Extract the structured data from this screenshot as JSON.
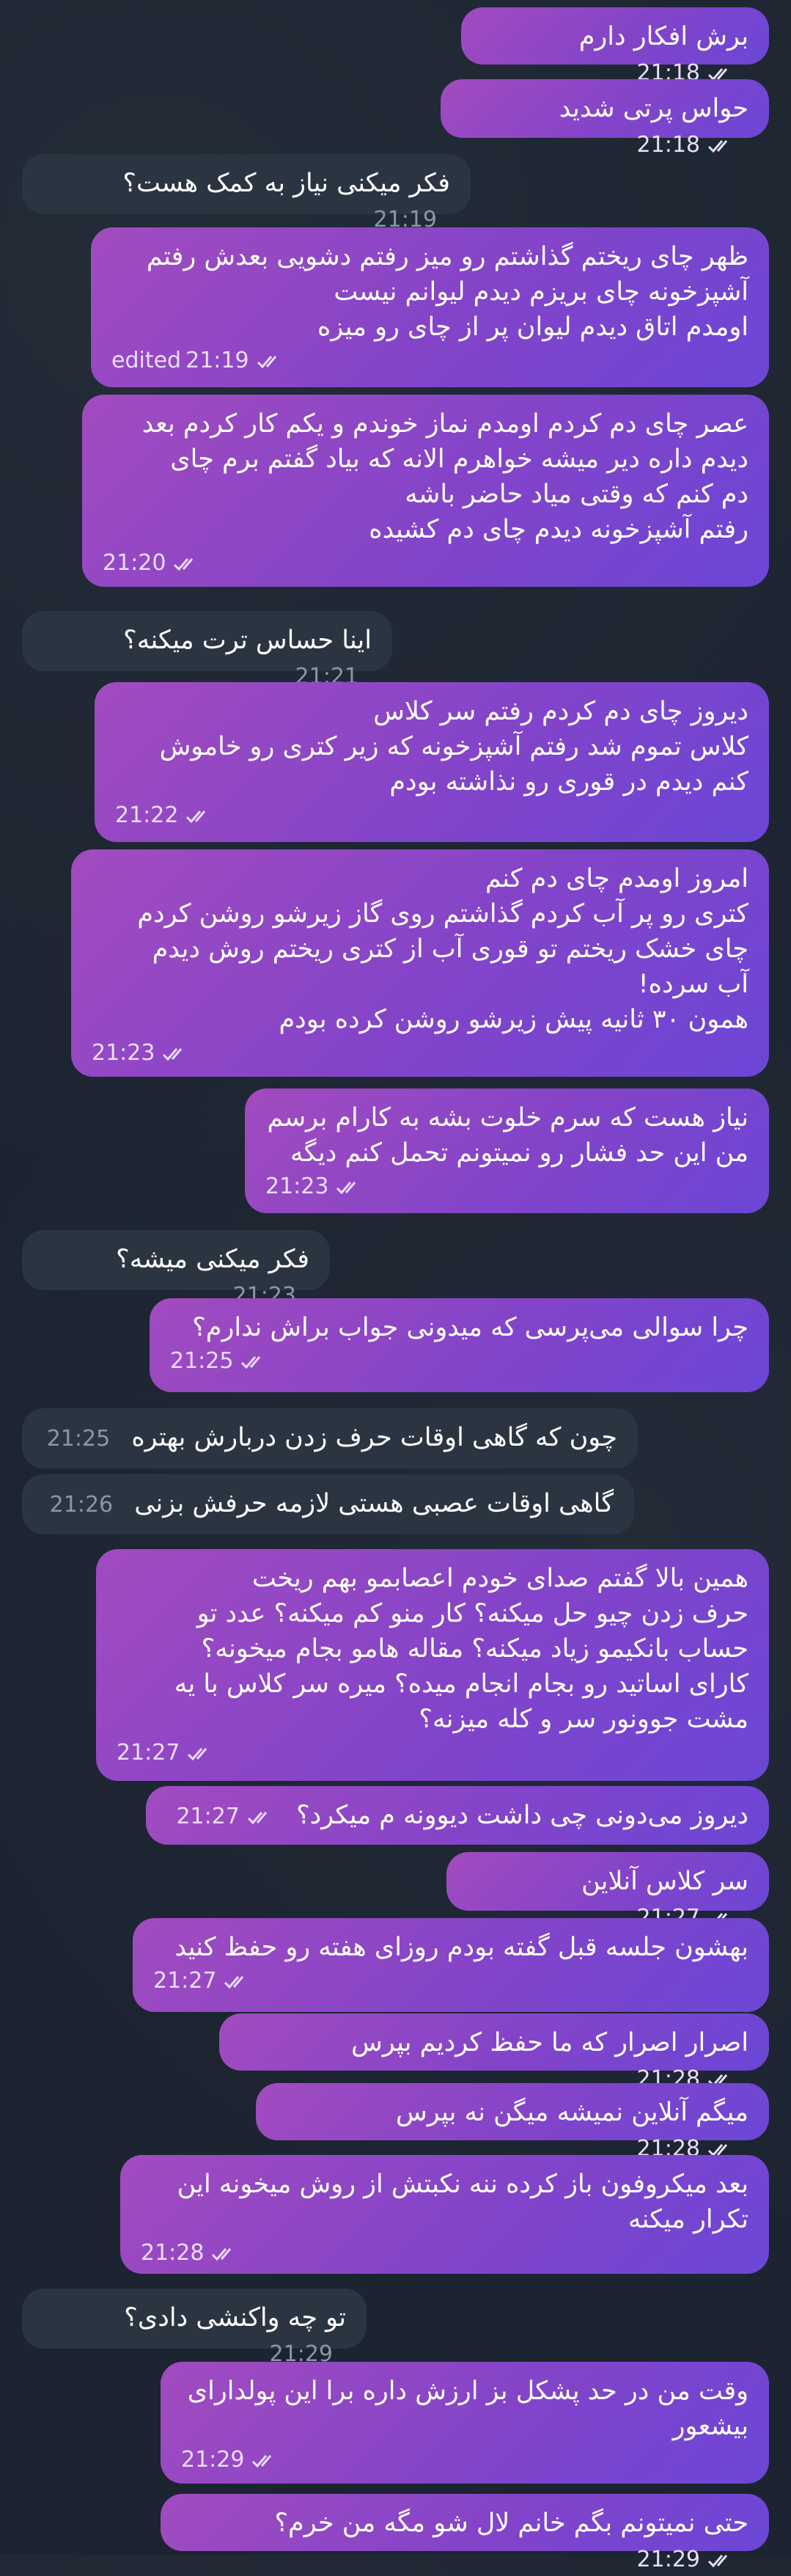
{
  "messages": [
    {
      "dir": "out",
      "text": "برش افکار دارم",
      "time": "21:18"
    },
    {
      "dir": "out",
      "text": "حواس پرتی شدید",
      "time": "21:18"
    },
    {
      "dir": "in",
      "text": "فکر میکنی نیاز به کمک هست؟",
      "time": "21:19"
    },
    {
      "dir": "out",
      "text": "ظهر چای ریختم گذاشتم رو میز رفتم دشویی بعدش رفتم\nآشپزخونه چای بریزم دیدم لیوانم نیست\nاومدم اتاق دیدم لیوان پر از چای رو میزه",
      "time": "21:19",
      "edited": "edited"
    },
    {
      "dir": "out",
      "text": "عصر چای دم کردم اومدم نماز خوندم و یکم کار کردم بعد\nدیدم داره دیر میشه خواهرم الانه که بیاد گفتم برم چای\nدم کنم که وقتی میاد حاضر باشه\nرفتم آشپزخونه دیدم چای دم کشیده",
      "time": "21:20"
    },
    {
      "dir": "in",
      "text": "اینا حساس ترت میکنه؟",
      "time": "21:21"
    },
    {
      "dir": "out",
      "text": "دیروز چای دم کردم رفتم سر کلاس\nکلاس تموم شد رفتم آشپزخونه که زیر کتری رو خاموش\nکنم دیدم در قوری رو نذاشته بودم",
      "time": "21:22"
    },
    {
      "dir": "out",
      "text": "امروز اومدم چای دم کنم\nکتری رو پر آب کردم گذاشتم روی گاز زیرشو روشن کردم\nچای خشک ریختم تو قوری آب از کتری ریختم روش دیدم\nآب سرده!\nهمون ۳۰ ثانیه پیش زیرشو روشن کرده بودم",
      "time": "21:23"
    },
    {
      "dir": "out",
      "text": "نیاز هست که سرم خلوت بشه به کارام برسم\nمن این حد فشار رو نمیتونم تحمل کنم دیگه",
      "time": "21:23"
    },
    {
      "dir": "in",
      "text": "فکر میکنی میشه؟",
      "time": "21:23"
    },
    {
      "dir": "out",
      "text": "چرا سوالی می‌پرسی که میدونی جواب براش ندارم؟",
      "time": "21:25"
    },
    {
      "dir": "in",
      "text": "چون که گاهی اوقات حرف زدن دربارش بهتره",
      "time": "21:25"
    },
    {
      "dir": "in",
      "text": "گاهی اوقات عصبی هستی لازمه حرفش بزنی",
      "time": "21:26"
    },
    {
      "dir": "out",
      "text": "همین بالا گفتم صدای خودم اعصابمو بهم ریخت\nحرف زدن چیو حل میکنه؟ کار منو کم میکنه؟ عدد تو\nحساب بانکیمو زیاد میکنه؟ مقاله هامو بجام میخونه؟\nکارای اساتید رو بجام انجام میده؟ میره سر کلاس با یه\nمشت جوونور سر و کله میزنه؟",
      "time": "21:27"
    },
    {
      "dir": "out",
      "text": "دیروز می‌دونی چی داشت دیوونه م میکرد؟",
      "time": "21:27"
    },
    {
      "dir": "out",
      "text": "سر کلاس آنلاین",
      "time": "21:27"
    },
    {
      "dir": "out",
      "text": "بهشون جلسه قبل گفته بودم روزای هفته رو حفظ کنید",
      "time": "21:27"
    },
    {
      "dir": "out",
      "text": "اصرار اصرار که ما حفظ کردیم بپرس",
      "time": "21:28"
    },
    {
      "dir": "out",
      "text": "میگم آنلاین نمیشه میگن نه بپرس",
      "time": "21:28"
    },
    {
      "dir": "out",
      "text": "بعد میکروفون باز کرده ننه نکبتش از روش میخونه این\nتکرار میکنه",
      "time": "21:28"
    },
    {
      "dir": "in",
      "text": "تو چه واکنشی دادی؟",
      "time": "21:29"
    },
    {
      "dir": "out",
      "text": "وقت من در حد پشکل بز ارزش داره برا این پولدارای\nبیشعور",
      "time": "21:29"
    },
    {
      "dir": "out",
      "text": "حتی نمیتونم بگم خانم لال شو مگه من خرم؟",
      "time": "21:29"
    }
  ]
}
